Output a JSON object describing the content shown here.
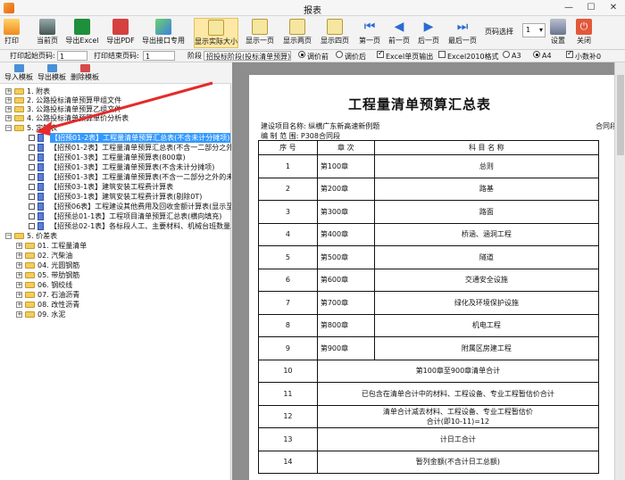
{
  "window": {
    "title": "报表",
    "min_glyph": "—",
    "max_glyph": "☐",
    "close_glyph": "✕"
  },
  "toolbar": {
    "print": "打印",
    "current_page": "当前页",
    "export_excel": "导出Excel",
    "export_pdf": "导出PDF",
    "export_interface": "导出接口专用",
    "show_actual_size": "显示实际大小",
    "show_one_page": "显示一页",
    "show_two_pages": "显示两页",
    "show_four_pages": "显示四页",
    "first_page": "第一页",
    "prev_page": "前一页",
    "next_page": "后一页",
    "last_page": "最后一页",
    "page_select_label": "页码选择",
    "page_select_value": "1",
    "settings": "设置",
    "close": "关闭"
  },
  "options": {
    "print_start_label": "打印起始页码:",
    "print_start_value": "1",
    "print_end_label": "打印结束页码:",
    "print_end_value": "1",
    "stage_label": "阶段",
    "stage_value": "招投标阶段(投标清单预算)",
    "adjust_before": "调价前",
    "adjust_after": "调价后",
    "excel_single": "Excel单页输出",
    "excel2010": "Excel2010格式",
    "a3": "A3",
    "a4": "A4",
    "decimal": "小数补0"
  },
  "left_tools": {
    "import_template": "导入模板",
    "export_template": "导出模板",
    "delete_template": "删除模板"
  },
  "tree": {
    "top": [
      "1. 附表",
      "2. 公路投标清单预算甲组文件",
      "3. 公路投标清单预算乙组文件",
      "4. 公路投标清单预算单价分析表",
      "5. 定制表"
    ],
    "custom": [
      "【招预01-2表】工程量清单预算汇总表(不含未计分摊项)",
      "【招预01-2表】工程量清单预算汇总表(不含一二部分之外的",
      "【招预01-3表】工程量清单预算表(800章)",
      "【招预01-3表】工程量清单预算表(不含未计分摊项)",
      "【招预01-3表】工程量清单预算表(不含一二部分之外的未计",
      "【招预03-1表】建筑安装工程费计算表",
      "【招预03-1表】建筑安装工程费计算表(剔除0T)",
      "【招预06表】工程建设其他费用及回收金额计算表(显示至前",
      "【招预总01-1表】工程项目清单预算汇总表(横向填充)",
      "【招预总02-1表】各标段人工、主要材料、机械台班数量单"
    ],
    "price_label": "5. 价差表",
    "price": [
      "01. 工程量清单",
      "02. 汽柴油",
      "04. 光圆钢筋",
      "05. 带肋钢筋",
      "06. 钢绞线",
      "07. 石油沥青",
      "08. 改性沥青",
      "09. 水泥"
    ]
  },
  "report": {
    "title": "工程量清单预算汇总表",
    "project_label": "建设项目名称:",
    "project_value": "纵横广东新高速新例题",
    "contract_right": "合同段",
    "scope_label": "编 制 范 围:",
    "scope_value": "P308合同段",
    "headers": [
      "序 号",
      "章 次",
      "科 目 名 称"
    ],
    "rows": [
      {
        "no": "1",
        "chapter": "第100章",
        "name": "总则"
      },
      {
        "no": "2",
        "chapter": "第200章",
        "name": "路基"
      },
      {
        "no": "3",
        "chapter": "第300章",
        "name": "路面"
      },
      {
        "no": "4",
        "chapter": "第400章",
        "name": "桥涵、涵洞工程"
      },
      {
        "no": "5",
        "chapter": "第500章",
        "name": "隧道"
      },
      {
        "no": "6",
        "chapter": "第600章",
        "name": "交通安全设施"
      },
      {
        "no": "7",
        "chapter": "第700章",
        "name": "绿化及环境保护设施"
      },
      {
        "no": "8",
        "chapter": "第800章",
        "name": "机电工程"
      },
      {
        "no": "9",
        "chapter": "第900章",
        "name": "附属区房建工程"
      }
    ],
    "summary": [
      {
        "no": "10",
        "name": "第100章至900章清单合计"
      },
      {
        "no": "11",
        "name": "已包含在清单合计中的材料、工程设备、专业工程暂估价合计"
      },
      {
        "no": "12",
        "name": "清单合计减去材料、工程设备、专业工程暂估价",
        "sub": "合计(即10-11)=12"
      },
      {
        "no": "13",
        "name": "计日工合计"
      },
      {
        "no": "14",
        "name": "暂列金额(不含计日工总额)"
      }
    ]
  },
  "colors": {
    "accent_selected": "#3399ff",
    "active_button": "#fde8a6",
    "annotation_arrow": "#e52b2b"
  }
}
